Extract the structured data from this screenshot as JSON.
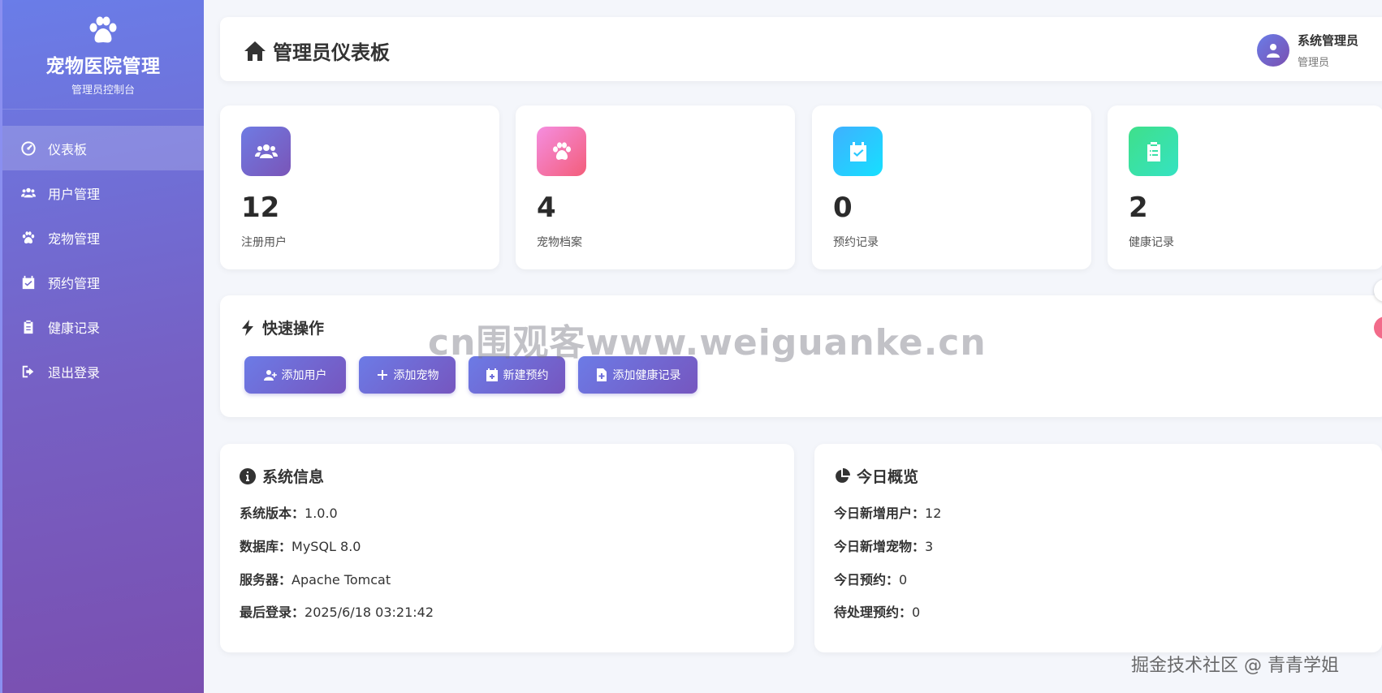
{
  "brand": {
    "title": "宠物医院管理",
    "subtitle": "管理员控制台"
  },
  "sidebar": {
    "items": [
      {
        "label": "仪表板",
        "icon": "dashboard-icon",
        "active": true
      },
      {
        "label": "用户管理",
        "icon": "users-icon",
        "active": false
      },
      {
        "label": "宠物管理",
        "icon": "paw-icon",
        "active": false
      },
      {
        "label": "预约管理",
        "icon": "calendar-check-icon",
        "active": false
      },
      {
        "label": "健康记录",
        "icon": "clipboard-icon",
        "active": false
      },
      {
        "label": "退出登录",
        "icon": "sign-out-icon",
        "active": false
      }
    ]
  },
  "header": {
    "title": "管理员仪表板",
    "user_name": "系统管理员",
    "user_role": "管理员"
  },
  "stats": [
    {
      "value": "12",
      "label": "注册用户",
      "icon": "users-icon",
      "gradient": [
        "#6f7be3",
        "#7a55b8"
      ]
    },
    {
      "value": "4",
      "label": "宠物档案",
      "icon": "paw-icon",
      "gradient": [
        "#f58ee0",
        "#f35d7a"
      ]
    },
    {
      "value": "0",
      "label": "预约记录",
      "icon": "calendar-check-icon",
      "gradient": [
        "#3fb0ff",
        "#16e0ff"
      ]
    },
    {
      "value": "2",
      "label": "健康记录",
      "icon": "clipboard-icon",
      "gradient": [
        "#3fe08a",
        "#35e2c2"
      ]
    }
  ],
  "quick_actions": {
    "title": "快速操作",
    "buttons": [
      {
        "label": "添加用户",
        "icon": "user-plus-icon"
      },
      {
        "label": "添加宠物",
        "icon": "plus-icon"
      },
      {
        "label": "新建预约",
        "icon": "calendar-plus-icon"
      },
      {
        "label": "添加健康记录",
        "icon": "file-plus-icon"
      }
    ]
  },
  "system_info": {
    "title": "系统信息",
    "rows": [
      {
        "key": "系统版本：",
        "value": "1.0.0"
      },
      {
        "key": "数据库：",
        "value": "MySQL 8.0"
      },
      {
        "key": "服务器：",
        "value": "Apache Tomcat"
      },
      {
        "key": "最后登录：",
        "value": "2025/6/18 03:21:42"
      }
    ]
  },
  "today_overview": {
    "title": "今日概览",
    "rows": [
      {
        "key": "今日新增用户：",
        "value": "12"
      },
      {
        "key": "今日新增宠物：",
        "value": "3"
      },
      {
        "key": "今日预约：",
        "value": "0"
      },
      {
        "key": "待处理预约：",
        "value": "0"
      }
    ]
  },
  "overlays": {
    "watermark": "cn围观客www.weiguanke.cn",
    "footer": "掘金技术社区 @ 青青学姐"
  },
  "colors": {
    "accent": "#7066d0",
    "background": "#f4f6fb"
  }
}
